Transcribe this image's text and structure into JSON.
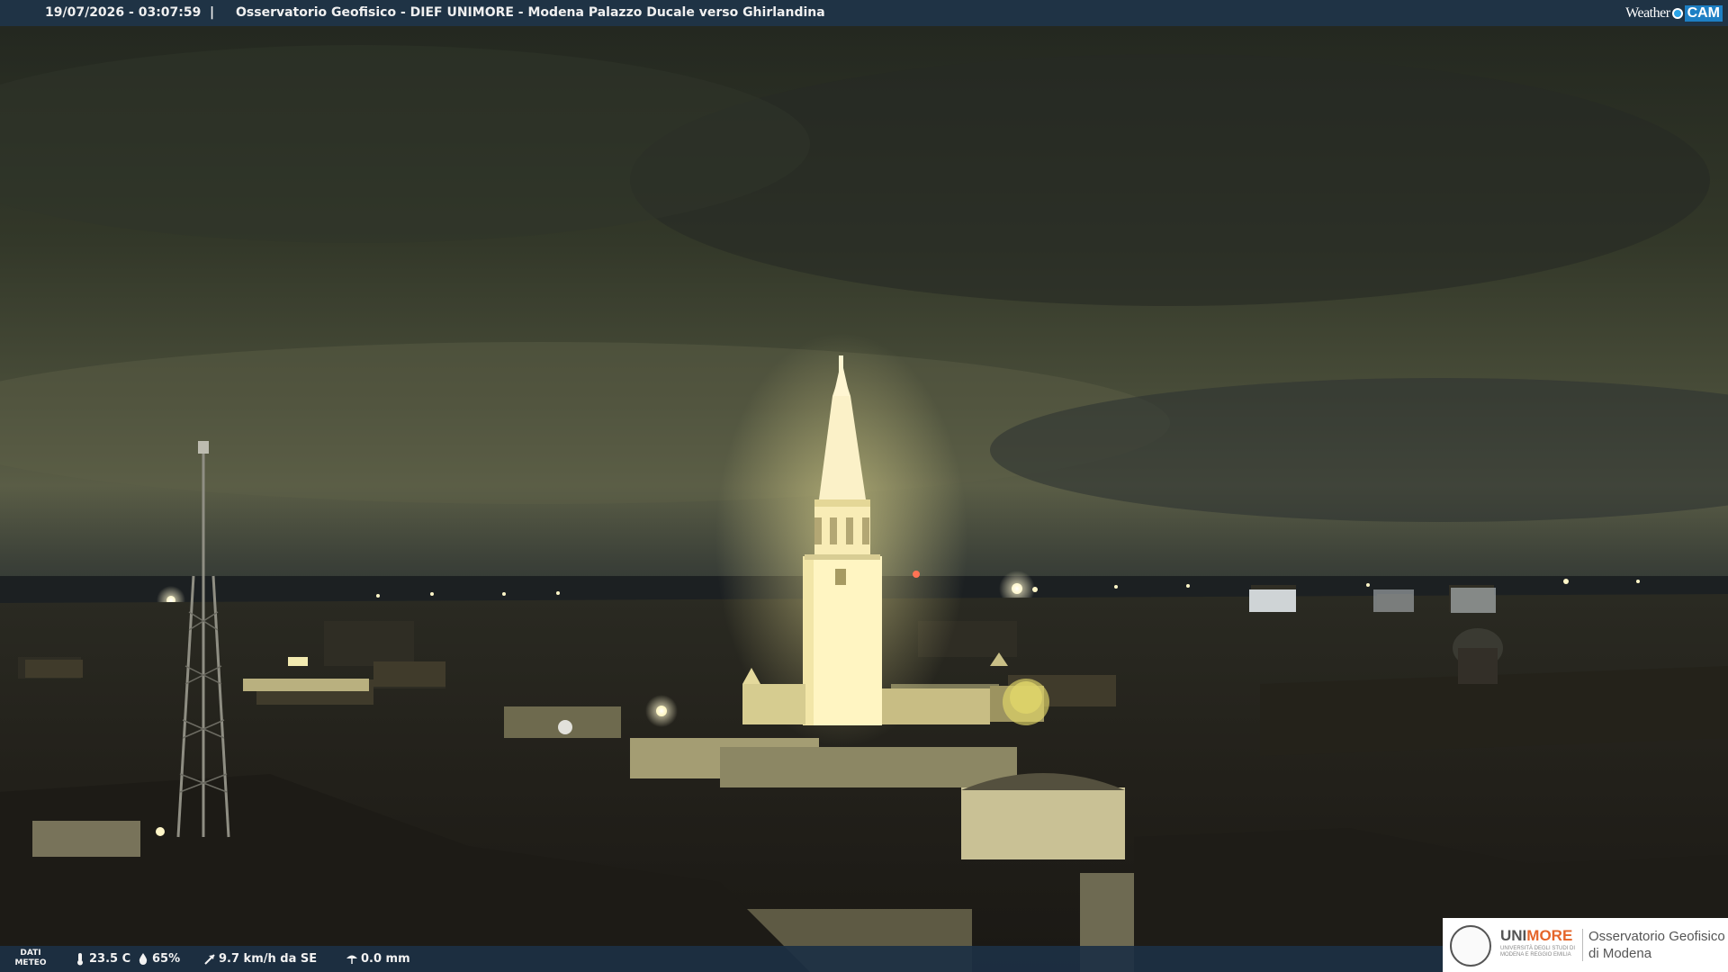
{
  "header": {
    "timestamp": "19/07/2026 - 03:07:59",
    "separator": "|",
    "title": "Osservatorio Geofisico - DIEF UNIMORE - Modena Palazzo Ducale verso Ghirlandina",
    "brand_weather": "Weather",
    "brand_cam": "CAM"
  },
  "meteo": {
    "label": "DATI METEO",
    "temperature": "23.5 C",
    "humidity": "65%",
    "wind": "9.7 km/h da SE",
    "rain": "0.0 mm"
  },
  "logo": {
    "uni_a": "UNI",
    "uni_b": "MORE",
    "uni_sub": "UNIVERSITÀ DEGLI STUDI DI MODENA E REGGIO EMILIA",
    "obs_line1": "Osservatorio Geofisico",
    "obs_line2": "di Modena"
  },
  "colors": {
    "bar": "#1f3345",
    "accent": "#e5652a",
    "brand_blue": "#1d7fc4"
  }
}
